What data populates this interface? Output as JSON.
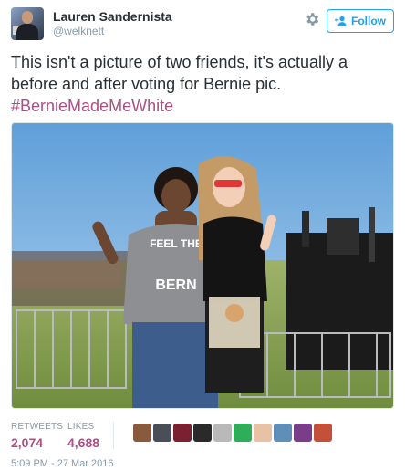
{
  "author": {
    "display_name": "Lauren Sandernista",
    "handle": "@welknett"
  },
  "actions": {
    "follow_label": "Follow"
  },
  "tweet": {
    "text": "This isn't a picture of two friends, it's actually a before and after voting for Bernie pic.",
    "hashtag": "#BernieMadeMeWhite"
  },
  "photo": {
    "shirt_text_top": "FEEL THE",
    "shirt_text_bottom": "BERN"
  },
  "stats": {
    "retweets_label": "RETWEETS",
    "retweets_value": "2,074",
    "likes_label": "LIKES",
    "likes_value": "4,688"
  },
  "likers": [
    {
      "color": "#8a5a3c"
    },
    {
      "color": "#4a4f57"
    },
    {
      "color": "#7a2030"
    },
    {
      "color": "#2a2a2a"
    },
    {
      "color": "#b9b9b9"
    },
    {
      "color": "#2fae5a"
    },
    {
      "color": "#e7c2a4"
    },
    {
      "color": "#5f8fb8"
    },
    {
      "color": "#7a3d8a"
    },
    {
      "color": "#c5503a"
    }
  ],
  "timestamp": "5:09 PM - 27 Mar 2016",
  "colors": {
    "accent": "#ab4f87",
    "follow_blue": "#1da1f2",
    "muted": "#8899a6"
  }
}
